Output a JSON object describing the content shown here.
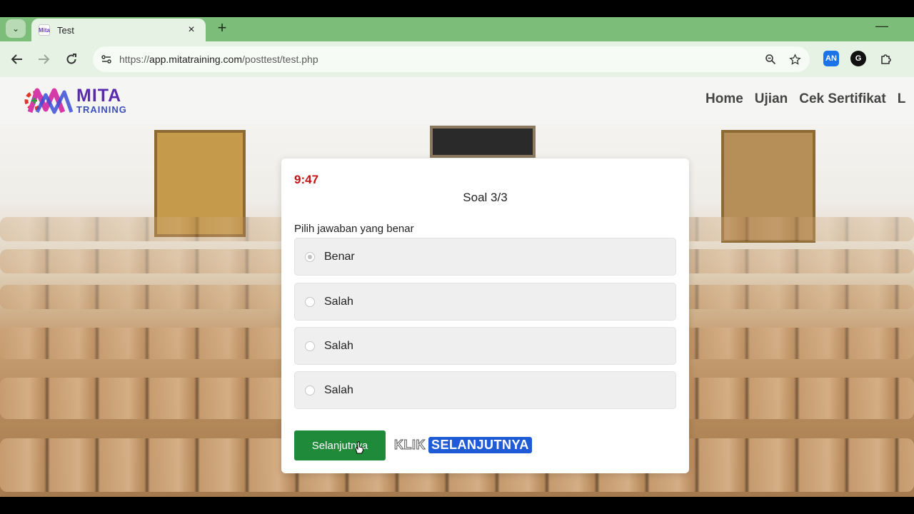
{
  "browser": {
    "tab": {
      "title": "Test",
      "favicon_text": "Mita",
      "close_icon": "×"
    },
    "new_tab_icon": "+",
    "tab_menu_icon": "⌄",
    "minimize_icon": "—",
    "url": {
      "prefix": "https://",
      "host": "app.mitatraining.com",
      "path": "/posttest/test.php"
    },
    "extensions": [
      {
        "label": "AN",
        "color": "#1a73e8"
      },
      {
        "label": "G",
        "color": "#111111"
      },
      {
        "label": "⧉",
        "color": "#333333"
      }
    ]
  },
  "site": {
    "logo": {
      "line1": "MITA",
      "line2": "TRAINING"
    },
    "menu": [
      "Home",
      "Ujian",
      "Cek Sertifikat",
      "L"
    ]
  },
  "quiz": {
    "timer": "9:47",
    "question_counter": "Soal 3/3",
    "prompt": "Pilih jawaban yang benar",
    "options": [
      {
        "label": "Benar",
        "selected": true
      },
      {
        "label": "Salah",
        "selected": false
      },
      {
        "label": "Salah",
        "selected": false
      },
      {
        "label": "Salah",
        "selected": false
      }
    ],
    "next_button": "Selanjutnya",
    "hint": {
      "word1": "KLIK",
      "word2": "SELANJUTNYA"
    }
  },
  "colors": {
    "browser_green": "#7dbd7a",
    "next_button": "#1f8a39",
    "timer": "#c41212",
    "hint_blue": "#1f5bd6"
  }
}
